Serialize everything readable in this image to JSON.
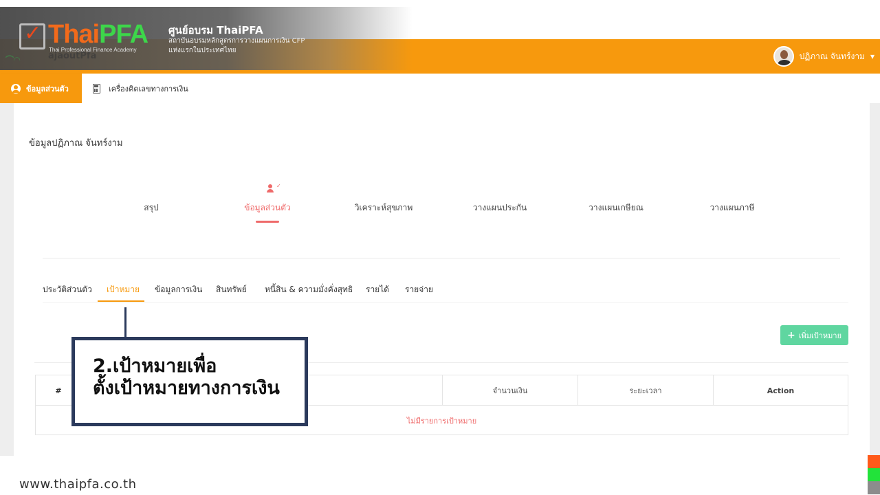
{
  "brand": {
    "logo_primary": "Thai",
    "logo_secondary": "PFA",
    "logo_tagline": "Thai Professional Finance Academy",
    "ghost_text": "ajaoutPfa",
    "org_title": "ศูนย์อบรม ThaiPFA",
    "org_subtitle_1": "สถาบันอบรมหลักสูตรการวางแผนการเงิน CFP",
    "org_subtitle_2": "แห่งแรกในประเทศไทย"
  },
  "user": {
    "name": "ปฏิภาณ จันทร์งาม",
    "caret": "▾"
  },
  "nav": {
    "active_label": "ข้อมูลส่วนตัว",
    "calculator_label": "เครื่องคิดเลขทางการเงิน"
  },
  "section": {
    "title": "ข้อมูลปฏิภาณ จันทร์งาม"
  },
  "main_tabs": [
    {
      "label": "สรุป"
    },
    {
      "label": "ข้อมูลส่วนตัว",
      "active": true
    },
    {
      "label": "วิเคราะห์สุขภาพ"
    },
    {
      "label": "วางแผนประกัน"
    },
    {
      "label": "วางแผนเกษียณ"
    },
    {
      "label": "วางแผนภาษี"
    }
  ],
  "sub_tabs": [
    {
      "label": "ประวัติส่วนตัว"
    },
    {
      "label": "เป้าหมาย",
      "active": true
    },
    {
      "label": "ข้อมูลการเงิน"
    },
    {
      "label": "สินทรัพย์"
    },
    {
      "label": "หนี้สิน & ความมั่งคั่งสุทธิ"
    },
    {
      "label": "รายได้"
    },
    {
      "label": "รายจ่าย"
    }
  ],
  "add_button": {
    "label": "เพิ่มเป้าหมาย"
  },
  "table": {
    "headers": [
      "#",
      "",
      "จำนวนเงิน",
      "ระยะเวลา",
      "Action"
    ],
    "empty_message": "ไม่มีรายการเป้าหมาย"
  },
  "callout": {
    "line1": "2.เป้าหมายเพื่อ",
    "line2": "ตั้งเป้าหมายทางการเงิน"
  },
  "footer": {
    "url": "www.thaipfa.co.th"
  },
  "colors": {
    "header_orange": "#f7990d",
    "accent_red": "#ef6a6a",
    "add_button_green": "#5fd6a0",
    "callout_border": "#2b3a5c",
    "stripe_orange": "#ff5a1a",
    "stripe_green": "#22e33a",
    "stripe_gray": "#8c8c8c"
  }
}
